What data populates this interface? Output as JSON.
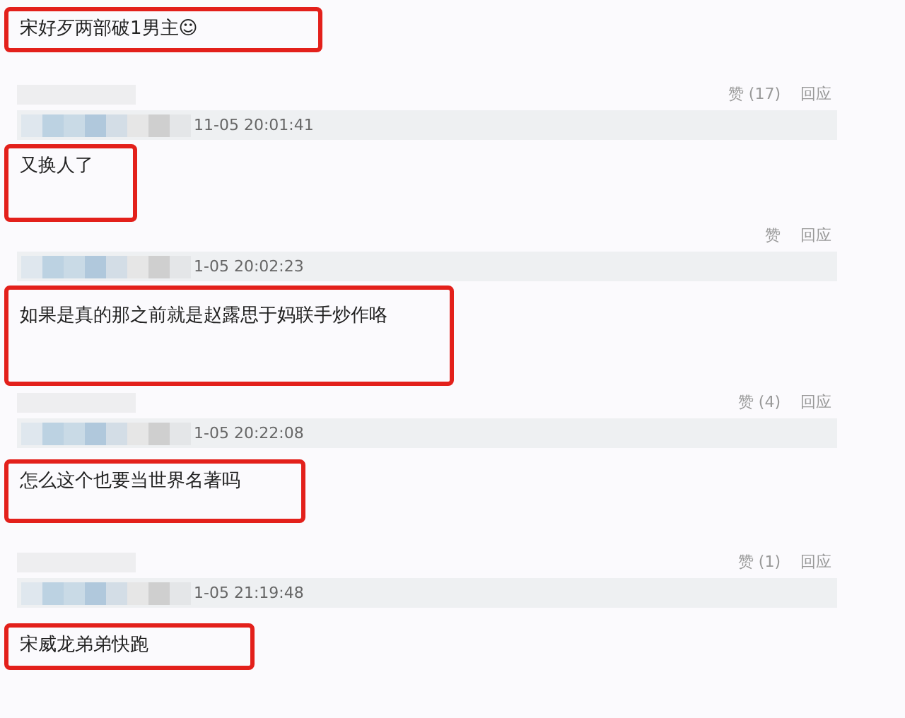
{
  "top_comment": {
    "text": "宋好歹两部破1男主☺"
  },
  "comments": [
    {
      "likes": "赞 (17)",
      "reply": "回应",
      "time": "11-05 20:01:41",
      "text": "又换人了"
    },
    {
      "likes": "赞",
      "reply": "回应",
      "time": "1-05 20:02:23",
      "text": "如果是真的那之前就是赵露思于妈联手炒作咯"
    },
    {
      "likes": "赞 (4)",
      "reply": "回应",
      "time": "1-05 20:22:08",
      "text": "怎么这个也要当世界名著吗"
    },
    {
      "likes": "赞 (1)",
      "reply": "回应",
      "time": "1-05 21:19:48",
      "text": "宋威龙弟弟快跑"
    }
  ]
}
